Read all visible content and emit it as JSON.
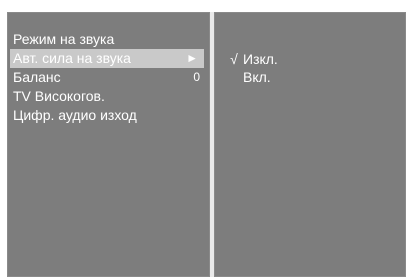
{
  "menu": {
    "items": [
      {
        "label": "Режим на звука",
        "value": "",
        "arrow": ""
      },
      {
        "label": "Авт. сила на звука",
        "value": "",
        "arrow": "►"
      },
      {
        "label": "Баланс",
        "value": "0",
        "arrow": ""
      },
      {
        "label": "TV Високогов.",
        "value": "",
        "arrow": ""
      },
      {
        "label": "Цифр. аудио изход",
        "value": "",
        "arrow": ""
      }
    ]
  },
  "submenu": {
    "options": [
      {
        "check": "√",
        "label": "Изкл."
      },
      {
        "check": "",
        "label": "Вкл."
      }
    ]
  },
  "colors": {
    "panel": "#7d7d7d",
    "selected": "#c9c9c9",
    "text": "#ffffff",
    "divider": "#e9e9e9"
  }
}
